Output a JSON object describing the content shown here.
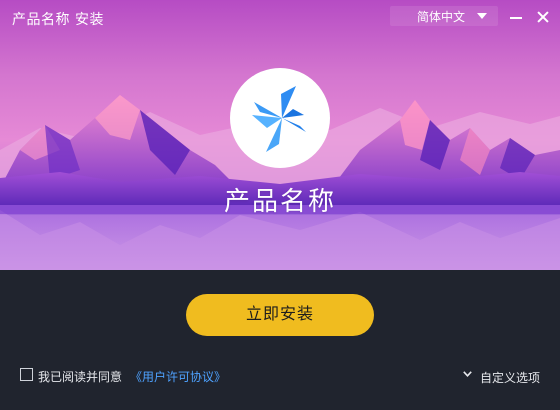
{
  "window": {
    "title": "产品名称 安装",
    "language_selector": {
      "value": "简体中文"
    },
    "controls": {
      "minimize_icon": "minimize-icon",
      "close_icon": "close-icon"
    }
  },
  "hero": {
    "logo_icon": "lightning-pinwheel-icon",
    "product_name": "产品名称",
    "colors": {
      "sky_top": "#b64cc4",
      "sky_mid": "#e68ad6",
      "mountains": "#6b2fc4"
    }
  },
  "actions": {
    "install_label": "立即安装",
    "install_color": "#f0bc1f",
    "agreement_checked": false,
    "agreement_text": "我已阅读并同意",
    "license_link": "《用户许可协议》",
    "custom_options_label": "自定义选项"
  },
  "colors": {
    "bottom_bg": "#20242e",
    "link": "#4ea2ff"
  }
}
